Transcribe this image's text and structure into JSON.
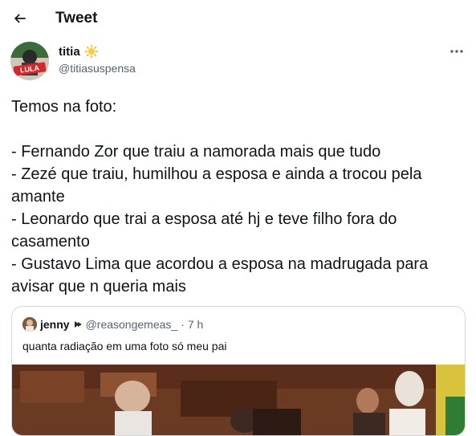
{
  "header": {
    "title": "Tweet",
    "back_icon": "arrow-left-icon"
  },
  "author": {
    "display_name": "titia",
    "emoji": "sun-icon",
    "handle": "@titiasuspensa",
    "avatar_badge": "LULA"
  },
  "tweet": {
    "lines": [
      "Temos na foto:",
      "",
      "- Fernando Zor que traiu a namorada mais que tudo",
      "- Zezé que traiu, humilhou a esposa e ainda a trocou pela amante",
      "- Leonardo que trai a esposa até hj e teve filho fora do casamento",
      "- Gustavo Lima que acordou a esposa na madrugada para avisar que n queria mais"
    ]
  },
  "quote": {
    "display_name": "jenny",
    "handle": "@reasongemeas_",
    "dot": "·",
    "time": "7 h",
    "text": "quanta radiação em uma foto só meu pai"
  },
  "colors": {
    "text": "#0f1419",
    "secondary": "#536471",
    "border": "#cfd9de"
  }
}
